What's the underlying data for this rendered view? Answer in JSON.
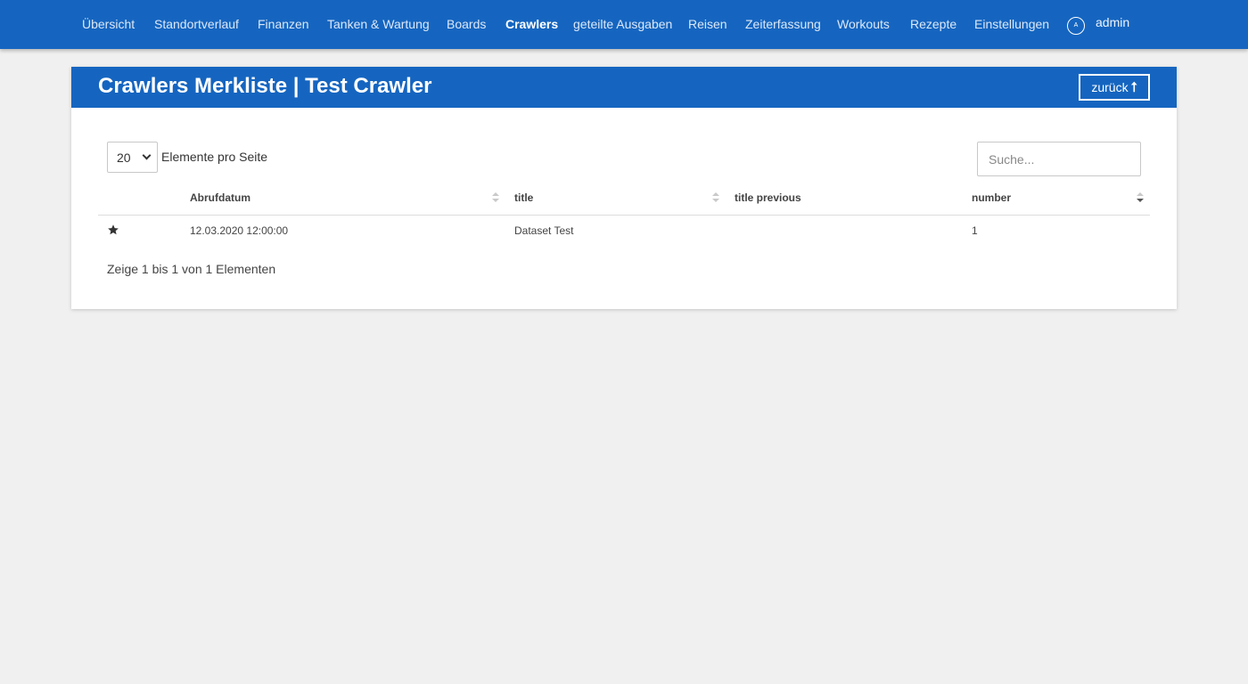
{
  "nav": {
    "items": [
      {
        "label": "Übersicht"
      },
      {
        "label": "Standortverlauf"
      },
      {
        "label": "Finanzen"
      },
      {
        "label": "Tanken & Wartung"
      },
      {
        "label": "Boards"
      },
      {
        "label": "Crawlers",
        "active": true
      },
      {
        "label": "geteilte Ausgaben"
      },
      {
        "label": "Reisen"
      },
      {
        "label": "Zeiterfassung"
      },
      {
        "label": "Workouts"
      },
      {
        "label": "Rezepte"
      },
      {
        "label": "Einstellungen"
      }
    ],
    "user": {
      "initial": "A",
      "name": "admin"
    }
  },
  "card": {
    "title": "Crawlers Merkliste | Test Crawler",
    "back_label": "zurück",
    "back_icon": "arrow-up-icon"
  },
  "controls": {
    "page_length": "20",
    "page_length_label": "Elemente pro Seite",
    "search_placeholder": "Suche..."
  },
  "table": {
    "columns": [
      "",
      "Abrufdatum",
      "title",
      "title previous",
      "number"
    ],
    "sort": {
      "column": "number",
      "direction": "desc"
    },
    "rows": [
      {
        "favorite_icon": "star-icon",
        "abrufdatum": "12.03.2020 12:00:00",
        "title": "Dataset Test",
        "title_previous": "",
        "number": "1"
      }
    ]
  },
  "info": "Zeige 1 bis 1 von 1 Elementen",
  "colors": {
    "primary": "#1565c0",
    "background": "#f0f0f0",
    "surface": "#ffffff"
  }
}
